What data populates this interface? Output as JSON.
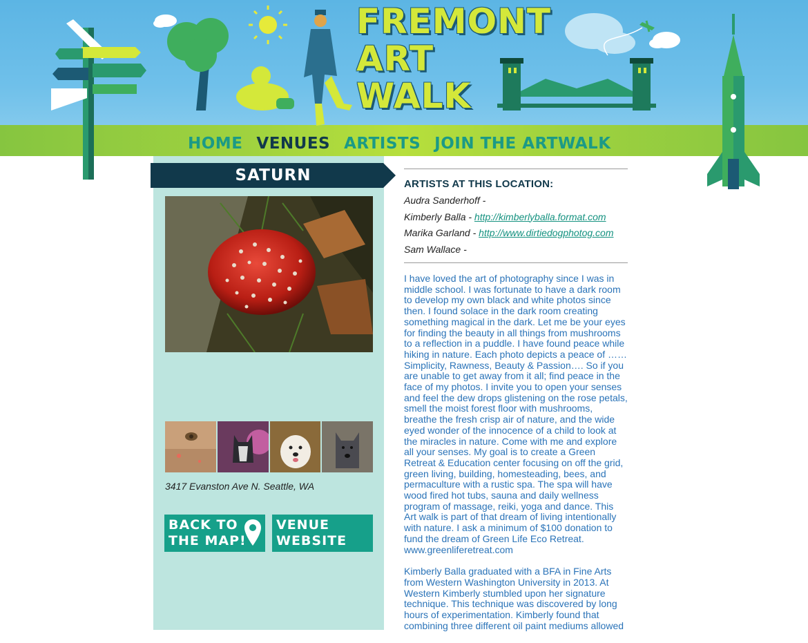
{
  "header": {
    "logo_lines": [
      "FREMONT",
      "ART",
      "WALK"
    ]
  },
  "nav": {
    "items": [
      "HOME",
      "VENUES",
      "ARTISTS",
      "JOIN THE ARTWALK"
    ]
  },
  "venue": {
    "name": "SATURN",
    "address": "3417 Evanston Ave N. Seattle, WA",
    "buttons": {
      "map_line1": "BACK TO",
      "map_line2": "THE MAP!",
      "web_line1": "VENUE",
      "web_line2": "WEBSITE"
    }
  },
  "artists": {
    "heading": "ARTISTS AT THIS LOCATION:",
    "list": [
      {
        "name": "Audra Sanderhoff -",
        "url": ""
      },
      {
        "name": "Kimberly Balla -",
        "url": "http://kimberlyballa.format.com"
      },
      {
        "name": "Marika Garland -",
        "url": "http://www.dirtiedogphotog.com"
      },
      {
        "name": "Sam Wallace -",
        "url": ""
      }
    ]
  },
  "bio": {
    "p1": "I have loved the art of photography since I was in middle school. I was fortunate to have a dark room to develop my own black and white photos since then. I found solace in the dark room creating something magical in the dark. Let me be your eyes for finding the beauty in all things from mushrooms to a reflection in a puddle. I have found peace while hiking in nature. Each photo depicts a peace of …… Simplicity, Rawness, Beauty & Passion…. So if you are unable to get away from it all; find peace in the face of my photos. I invite you to open your senses and feel the dew drops glistening on the rose petals, smell the moist forest floor with mushrooms, breathe the fresh crisp air of nature, and the wide eyed wonder of the innocence of a child to look at the miracles in nature. Come with me and explore all your senses. My goal is to create a Green Retreat & Education center focusing on off the grid, green living, building, homesteading, bees, and permaculture with a rustic spa. The spa will have wood fired hot tubs, sauna and daily wellness program of massage, reiki, yoga and dance. This Art walk is part of that dream of living intentionally with nature. I ask a minimum of $100 donation to fund the dream of Green Life Eco Retreat. www.greenliferetreat.com",
    "p2": "Kimberly Balla graduated with a BFA in Fine Arts from Western Washington University in 2013. At Western Kimberly stumbled upon her signature technique. This technique was discovered by long hours of experimentation. Kimberly found that combining three different oil paint mediums allowed"
  },
  "colors": {
    "sky": "#5cb5e4",
    "green_band": "#9fd23f",
    "navy": "#11394b",
    "teal": "#16a08a",
    "panel": "#bde5df",
    "bio_text": "#2a73b8"
  }
}
